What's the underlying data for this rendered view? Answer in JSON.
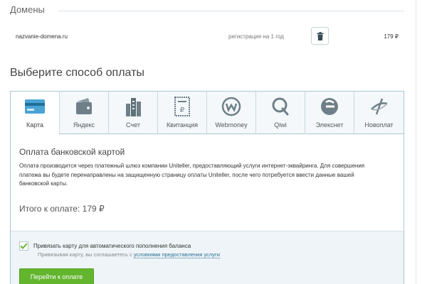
{
  "domains": {
    "title": "Домены",
    "row": {
      "name": "nazvanie-domena.ru",
      "period": "регистрация на 1 год",
      "price": "179 ₽",
      "delete_icon": "trash-icon"
    }
  },
  "payment": {
    "title": "Выберите способ оплаты",
    "tabs": [
      {
        "label": "Карта",
        "icon": "card-icon",
        "active": true
      },
      {
        "label": "Яндекс",
        "icon": "yandex-wallet-icon",
        "active": false
      },
      {
        "label": "Счет",
        "icon": "building-icon",
        "active": false
      },
      {
        "label": "Квитанция",
        "icon": "receipt-icon",
        "active": false
      },
      {
        "label": "Webmoney",
        "icon": "webmoney-icon",
        "active": false
      },
      {
        "label": "Qiwi",
        "icon": "qiwi-icon",
        "active": false
      },
      {
        "label": "Элекснет",
        "icon": "elecsnet-icon",
        "active": false
      },
      {
        "label": "Новоплат",
        "icon": "novoplat-icon",
        "active": false
      }
    ],
    "desc_title": "Оплата банковской картой",
    "desc_text": "Оплата производится через платежный шлюз компании Uniteller, предоставляющий услуги интернет-эквайринга. Для совершения платежа вы будете перенаправлены на защищенную страницу оплаты Uniteller, после чего потребуется ввести данные вашей банковской карты.",
    "total": "Итого к оплате: 179 ₽"
  },
  "autopay": {
    "checked": true,
    "label": "Привязать карту для автоматического пополнения баланса",
    "note_prefix": "Привязывая карту, вы соглашаетесь с ",
    "note_link": "условиями предоставления услуги"
  },
  "submit_label": "Перейти к оплате",
  "colors": {
    "accent": "#2a6f96",
    "button": "#63b52e",
    "border": "#a9c7d6",
    "check": "#63b52e"
  }
}
